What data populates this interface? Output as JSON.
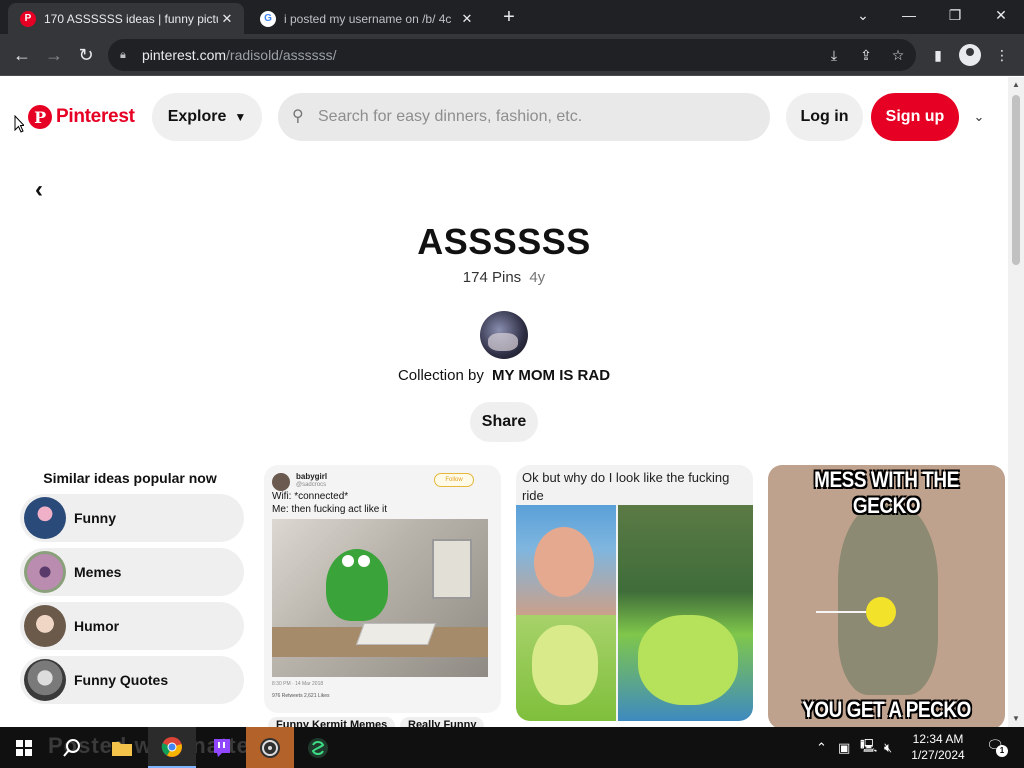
{
  "browser": {
    "tabs": [
      {
        "title": "170 ASSSSSS ideas | funny pictu",
        "favicon": "pinterest-icon",
        "active": true
      },
      {
        "title": "i posted my username on /b/ 4c",
        "favicon": "google-icon",
        "active": false
      }
    ],
    "address": {
      "host": "pinterest.com",
      "path": "/radisold/assssss/"
    },
    "icons": [
      "back-icon",
      "forward-icon",
      "reload-icon",
      "lock-icon",
      "install-icon",
      "share-icon",
      "star-icon",
      "sidepanel-icon",
      "profile-icon",
      "menu-icon"
    ]
  },
  "header": {
    "logo_text": "Pinterest",
    "explore_label": "Explore",
    "search_placeholder": "Search for easy dinners, fashion, etc.",
    "login_label": "Log in",
    "signup_label": "Sign up"
  },
  "board": {
    "title": "ASSSSSS",
    "pin_count": "174 Pins",
    "age": "4y",
    "collection_prefix": "Collection by",
    "owner": "MY MOM IS RAD",
    "share_label": "Share"
  },
  "similar": {
    "heading": "Similar ideas popular now",
    "items": [
      {
        "label": "Funny",
        "color": "#2a4a7a"
      },
      {
        "label": "Memes",
        "color": "#b98cb0"
      },
      {
        "label": "Humor",
        "color": "#6b5a4a"
      },
      {
        "label": "Funny Quotes",
        "color": "#7a7a7a"
      }
    ]
  },
  "pins": {
    "kermit": {
      "name": "babygirl",
      "handle": "@sadcrocs",
      "follow": "Follow",
      "text": "Wifi: *connected*\nMe: then fucking act like it",
      "timestamp": "8:30 PM · 14 Mar 2018",
      "stats": "976 Retweets   2,621 Likes",
      "chips": [
        "Funny Kermit Memes",
        "Really Funny"
      ]
    },
    "caterpillar": {
      "caption": "Ok but why do I look like the fucking ride"
    },
    "gecko": {
      "top_text": "MESS WITH THE GECKO",
      "bottom_text": "YOU GET A PECKO"
    }
  },
  "taskbar": {
    "watermark": "Posted       wasanattempt",
    "time": "12:34 AM",
    "date": "1/27/2024",
    "notification_count": "1"
  },
  "colors": {
    "brand": "#e60023",
    "chrome_dark": "#202124",
    "chrome_toolbar": "#35363a"
  }
}
